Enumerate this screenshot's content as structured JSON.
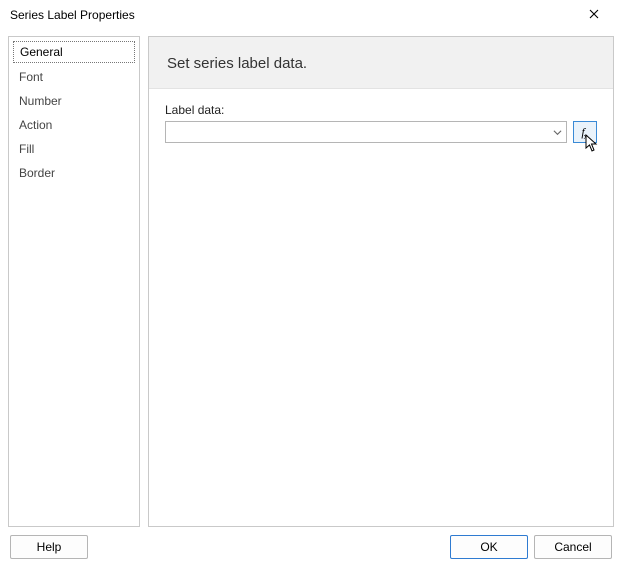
{
  "window": {
    "title": "Series Label Properties"
  },
  "sidebar": {
    "items": [
      {
        "label": "General",
        "selected": true
      },
      {
        "label": "Font",
        "selected": false
      },
      {
        "label": "Number",
        "selected": false
      },
      {
        "label": "Action",
        "selected": false
      },
      {
        "label": "Fill",
        "selected": false
      },
      {
        "label": "Border",
        "selected": false
      }
    ]
  },
  "content": {
    "header": "Set series label data.",
    "label_data_caption": "Label data:",
    "label_data_value": "",
    "fx_label": "f",
    "fx_sub": "x"
  },
  "footer": {
    "help": "Help",
    "ok": "OK",
    "cancel": "Cancel"
  }
}
